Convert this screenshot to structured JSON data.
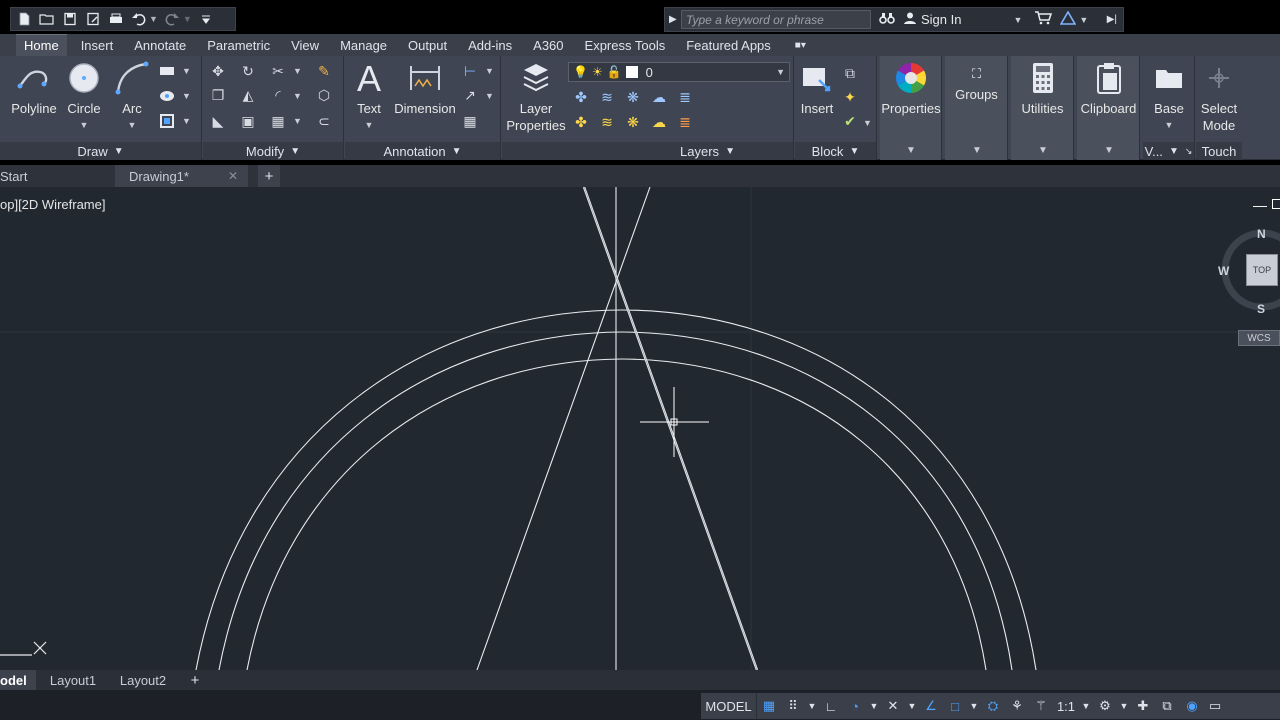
{
  "search": {
    "placeholder": "Type a keyword or phrase"
  },
  "account": {
    "signin_label": "Sign In"
  },
  "ribbon_tabs": [
    "Home",
    "Insert",
    "Annotate",
    "Parametric",
    "View",
    "Manage",
    "Output",
    "Add-ins",
    "A360",
    "Express Tools",
    "Featured Apps"
  ],
  "draw": {
    "polyline": "Polyline",
    "circle": "Circle",
    "arc": "Arc",
    "title": "Draw"
  },
  "modify": {
    "title": "Modify"
  },
  "annotation": {
    "text": "Text",
    "dimension": "Dimension",
    "title": "Annotation"
  },
  "layers": {
    "layer_props_1": "Layer",
    "layer_props_2": "Properties",
    "current_layer": "0",
    "title": "Layers"
  },
  "block": {
    "insert": "Insert",
    "title": "Block"
  },
  "properties": {
    "label": "Properties"
  },
  "groups": {
    "label": "Groups"
  },
  "utilities": {
    "label": "Utilities"
  },
  "clipboard": {
    "label": "Clipboard"
  },
  "view_panel": {
    "base": "Base",
    "title": "V..."
  },
  "touch": {
    "select_1": "Select",
    "select_2": "Mode",
    "title": "Touch"
  },
  "doc_tabs": {
    "start": "Start",
    "drawing": "Drawing1*"
  },
  "viewport": {
    "label": "op][2D Wireframe]"
  },
  "viewcube": {
    "n": "N",
    "s": "S",
    "w": "W",
    "top": "TOP",
    "wcs": "WCS"
  },
  "layout_tabs": {
    "model": "odel",
    "layout1": "Layout1",
    "layout2": "Layout2"
  },
  "status": {
    "model": "MODEL",
    "scale": "1:1"
  },
  "colors": {
    "canvas_bg": "#212830",
    "ribbon_bg": "#3f4552",
    "accent_blue": "#4fa3ff"
  }
}
